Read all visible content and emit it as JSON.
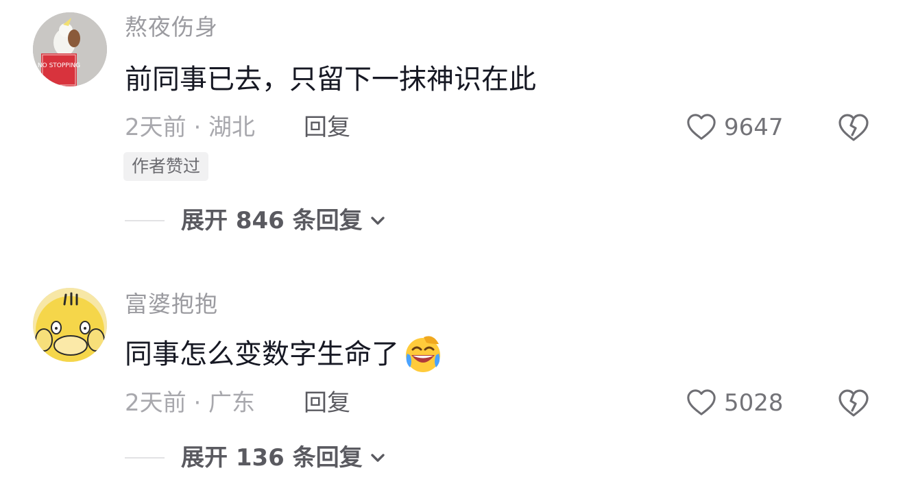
{
  "comments": [
    {
      "username": "熬夜伤身",
      "text": "前同事已去，只留下一抹神识在此",
      "meta": "2天前 · 湖北",
      "reply_label": "回复",
      "likes": "9647",
      "author_badge": "作者赞过",
      "expand_label": "展开 846 条回复",
      "avatar_sign_text": "NO STOPPING"
    },
    {
      "username": "富婆抱抱",
      "text": "同事怎么变数字生命了",
      "emoji": "laughing-crying-emoji",
      "meta": "2天前 · 广东",
      "reply_label": "回复",
      "likes": "5028",
      "expand_label": "展开 136 条回复"
    }
  ],
  "colors": {
    "username": "#9b9ba0",
    "text": "#161823",
    "meta": "#a8a8ad",
    "badge_bg": "#f1f1f2"
  }
}
